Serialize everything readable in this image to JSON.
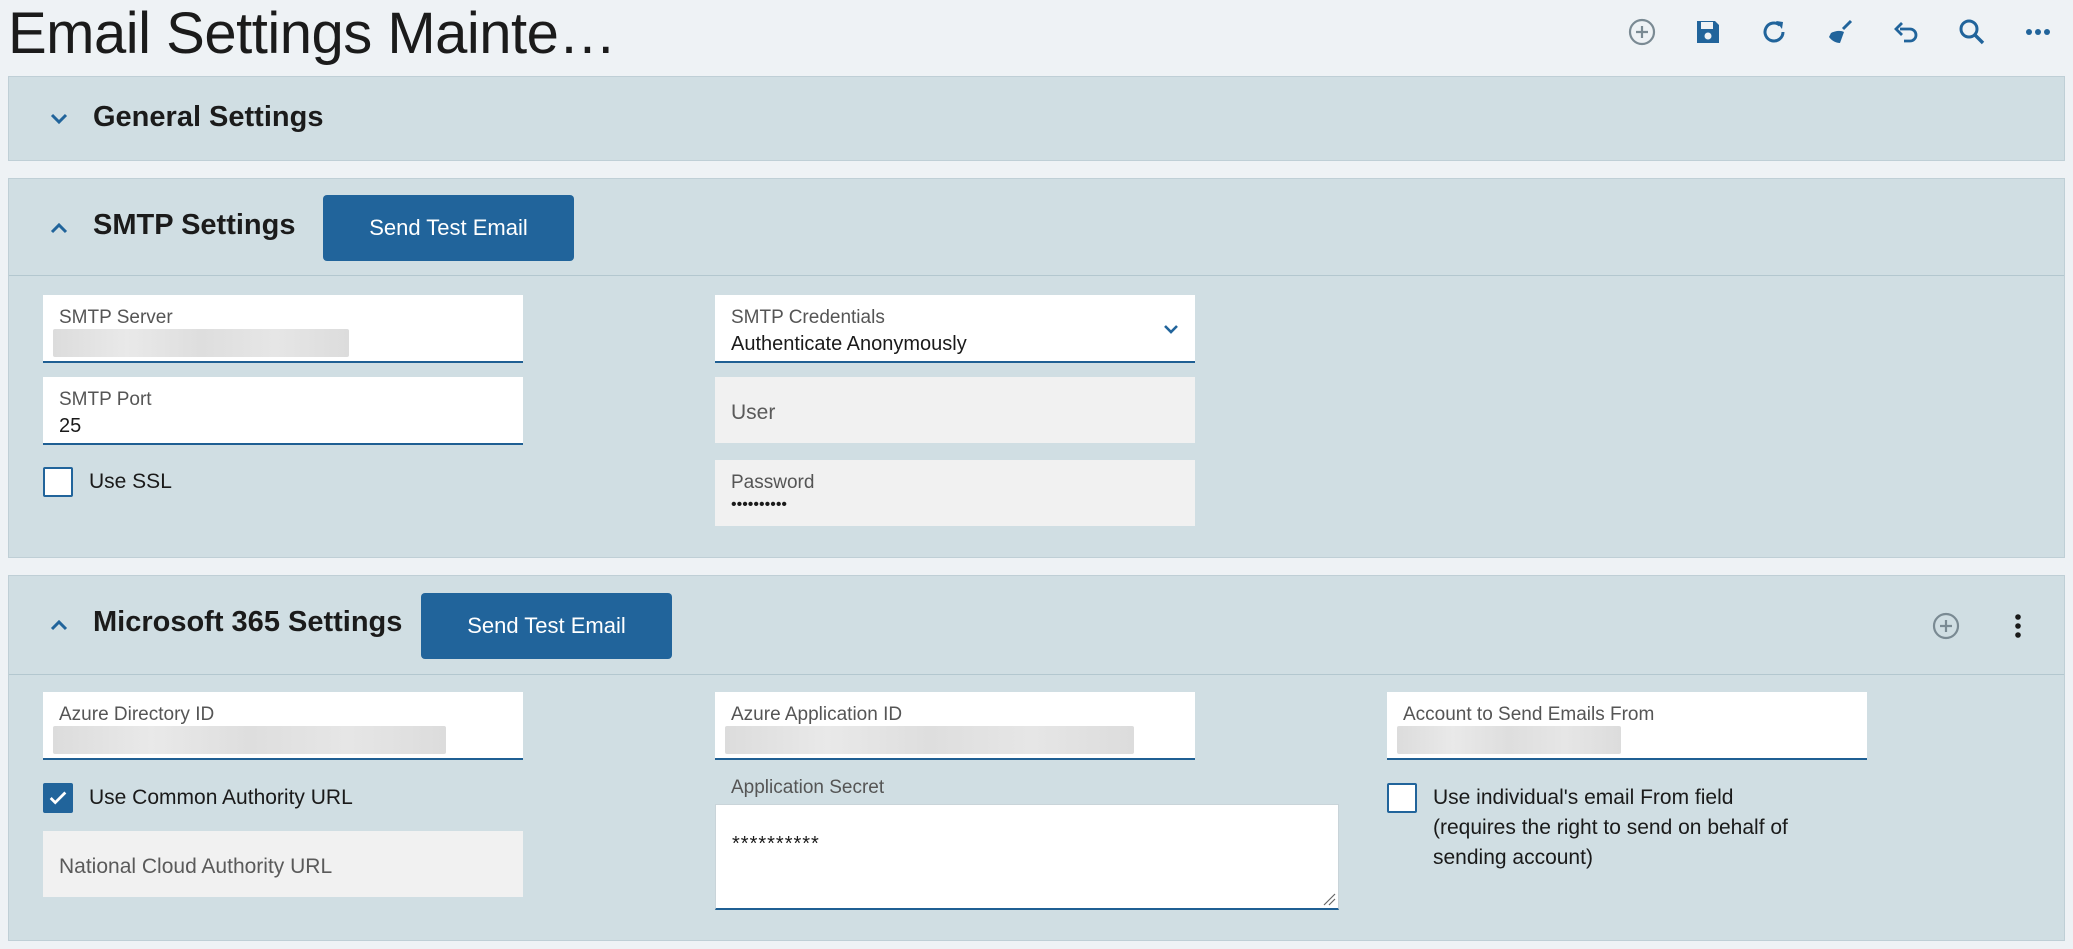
{
  "header": {
    "title": "Email Settings Mainte…",
    "toolbar": [
      {
        "name": "add-icon",
        "label": "Add"
      },
      {
        "name": "save-icon",
        "label": "Save"
      },
      {
        "name": "refresh-icon",
        "label": "Refresh"
      },
      {
        "name": "clear-icon",
        "label": "Clear"
      },
      {
        "name": "undo-icon",
        "label": "Undo"
      },
      {
        "name": "search-icon",
        "label": "Search"
      },
      {
        "name": "more-icon",
        "label": "More"
      }
    ]
  },
  "general": {
    "title": "General Settings",
    "expanded": false
  },
  "smtp": {
    "title": "SMTP Settings",
    "expanded": true,
    "send_test_label": "Send Test Email",
    "server": {
      "label": "SMTP Server",
      "value": ""
    },
    "port": {
      "label": "SMTP Port",
      "value": "25"
    },
    "use_ssl": {
      "label": "Use SSL",
      "checked": false
    },
    "credentials": {
      "label": "SMTP Credentials",
      "value": "Authenticate Anonymously"
    },
    "user": {
      "placeholder": "User"
    },
    "password": {
      "label": "Password",
      "value": "••••••••••"
    }
  },
  "m365": {
    "title": "Microsoft 365 Settings",
    "expanded": true,
    "send_test_label": "Send Test Email",
    "azure_directory_id": {
      "label": "Azure Directory ID",
      "value": ""
    },
    "azure_application_id": {
      "label": "Azure Application ID",
      "value": ""
    },
    "account_from": {
      "label": "Account to Send Emails From",
      "value": ""
    },
    "use_common_authority": {
      "label": "Use Common Authority URL",
      "checked": true
    },
    "national_cloud_url": {
      "placeholder": "National Cloud Authority URL"
    },
    "application_secret": {
      "label": "Application Secret",
      "value": "**********"
    },
    "use_individual_from": {
      "label_line1": "Use individual's email From field",
      "label_line2": "(requires the right to send on behalf of",
      "label_line3": "sending account)",
      "checked": false
    }
  },
  "colors": {
    "accent": "#21649b",
    "panel_bg": "#d0dee3",
    "page_bg": "#eef2f5"
  }
}
